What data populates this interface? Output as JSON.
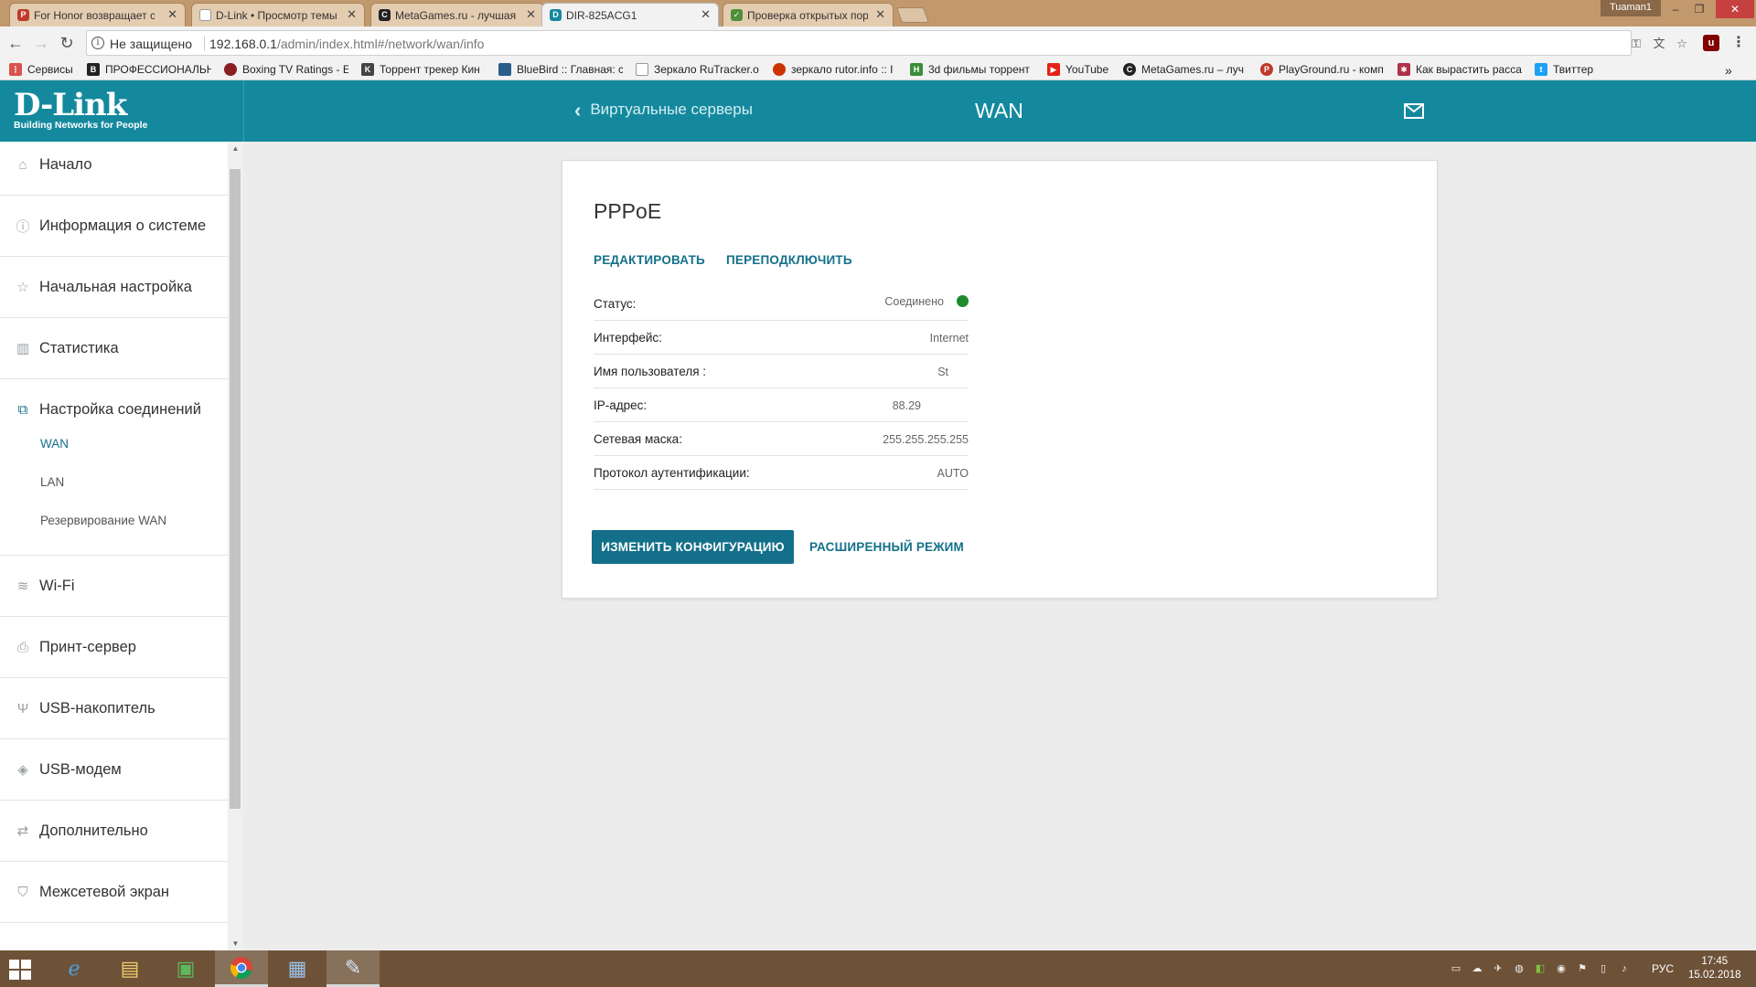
{
  "browser": {
    "tabs": [
      {
        "label": "For Honor возвращает с",
        "favicon": "pg-icon",
        "color": "#c0392b"
      },
      {
        "label": "D-Link • Просмотр темы",
        "favicon": "page-icon",
        "color": "#999999"
      },
      {
        "label": "MetaGames.ru - лучшая",
        "favicon": "metagames-icon",
        "color": "#222222"
      },
      {
        "label": "DIR-825ACG1",
        "favicon": "dlink-icon",
        "color": "#14899e"
      },
      {
        "label": "Проверка открытых пор",
        "favicon": "check-icon",
        "color": "#4f8f3a"
      }
    ],
    "user": "Tuaman1",
    "address": {
      "security_label": "Не защищено",
      "url_host": "192.168.0.1",
      "url_path": "/admin/index.html#/network/wan/info"
    },
    "bookmarks": [
      {
        "label": "Сервисы",
        "icon": "apps-icon",
        "color": "#d9534f"
      },
      {
        "label": "ПРОФЕССИОНАЛЬН",
        "icon": "b-icon",
        "color": "#222222"
      },
      {
        "label": "Boxing TV Ratings - E",
        "icon": "boxing-icon",
        "color": "#8b1f1f"
      },
      {
        "label": "Торрент трекер Кин",
        "icon": "k-icon",
        "color": "#444444"
      },
      {
        "label": "BlueBird :: Главная: с",
        "icon": "bluebird-icon",
        "color": "#2b5c8a"
      },
      {
        "label": "Зеркало RuTracker.o",
        "icon": "page-icon",
        "color": "#999999"
      },
      {
        "label": "зеркало rutor.info :: I",
        "icon": "rutor-icon",
        "color": "#cc3300"
      },
      {
        "label": "3d фильмы торрент",
        "icon": "h-icon",
        "color": "#3a8d3a"
      },
      {
        "label": "YouTube",
        "icon": "youtube-icon",
        "color": "#e62117"
      },
      {
        "label": "MetaGames.ru – луч",
        "icon": "metagames-icon",
        "color": "#222222"
      },
      {
        "label": "PlayGround.ru - комп",
        "icon": "pg-icon",
        "color": "#c0392b"
      },
      {
        "label": "Как вырастить расса",
        "icon": "plant-icon",
        "color": "#b0304a"
      },
      {
        "label": "Твиттер",
        "icon": "twitter-icon",
        "color": "#1da1f2"
      }
    ]
  },
  "app": {
    "brand": "D-Link",
    "tagline": "Building Networks for People",
    "back_label": "Виртуальные серверы",
    "title": "WAN",
    "accent": "#14899e",
    "link_color": "#14708a"
  },
  "sidebar": {
    "items": [
      {
        "label": "Начало",
        "icon": "home-icon"
      },
      {
        "label": "Информация о системе",
        "icon": "info-icon"
      },
      {
        "label": "Начальная настройка",
        "icon": "star-icon"
      },
      {
        "label": "Статистика",
        "icon": "bar-chart-icon"
      },
      {
        "label": "Настройка соединений",
        "icon": "connections-icon"
      },
      {
        "label": "Wi-Fi",
        "icon": "wifi-icon"
      },
      {
        "label": "Принт-сервер",
        "icon": "printer-icon"
      },
      {
        "label": "USB-накопитель",
        "icon": "usb-icon"
      },
      {
        "label": "USB-модем",
        "icon": "modem-icon"
      },
      {
        "label": "Дополнительно",
        "icon": "sliders-icon"
      },
      {
        "label": "Межсетевой экран",
        "icon": "shield-icon"
      }
    ],
    "subitems": [
      {
        "label": "WAN",
        "active": true
      },
      {
        "label": "LAN",
        "active": false
      },
      {
        "label": "Резервирование WAN",
        "active": false
      }
    ]
  },
  "card": {
    "title": "PPPoE",
    "edit_label": "РЕДАКТИРОВАТЬ",
    "reconnect_label": "ПЕРЕПОДКЛЮЧИТЬ",
    "rows": [
      {
        "label": "Статус:",
        "value": "Соединено"
      },
      {
        "label": "Интерфейс:",
        "value": "Internet"
      },
      {
        "label": "Имя пользователя :",
        "value": "St"
      },
      {
        "label": "IP-адрес:",
        "value": "88.29"
      },
      {
        "label": "Сетевая маска:",
        "value": "255.255.255.255"
      },
      {
        "label": "Протокол аутентификации:",
        "value": "AUTO"
      }
    ],
    "status_color": "#1e8a2e",
    "primary_button": "ИЗМЕНИТЬ КОНФИГУРАЦИЮ",
    "advanced_link": "РАСШИРЕННЫЙ РЕЖИМ"
  },
  "taskbar": {
    "language": "РУС",
    "time": "17:45",
    "date": "15.02.2018"
  }
}
